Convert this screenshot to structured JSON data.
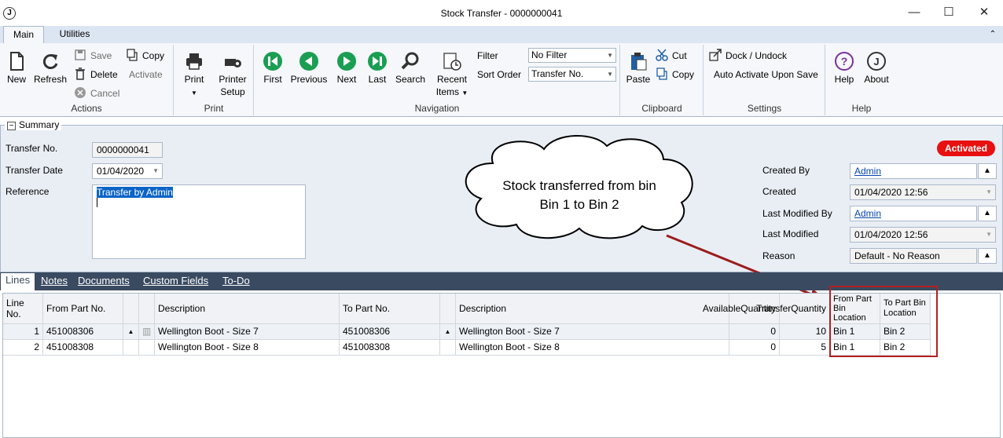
{
  "window": {
    "title": "Stock Transfer - 0000000041",
    "app_icon": "J",
    "min": "—",
    "max": "☐",
    "close": "✕"
  },
  "tabs": [
    {
      "label": "Main"
    },
    {
      "label": "Utilities"
    }
  ],
  "ribbon": {
    "actions": {
      "new": "New",
      "refresh": "Refresh",
      "save": "Save",
      "delete": "Delete",
      "cancel": "Cancel",
      "copy": "Copy",
      "activate": "Activate",
      "group": "Actions"
    },
    "print": {
      "print": "Print",
      "printer": "Printer",
      "setup": "Setup",
      "group": "Print"
    },
    "navigation": {
      "first": "First",
      "previous": "Previous",
      "next": "Next",
      "last": "Last",
      "search": "Search",
      "recent": "Recent",
      "items": "Items",
      "filter_label": "Filter",
      "filter_value": "No Filter",
      "sort_label": "Sort Order",
      "sort_value": "Transfer No.",
      "group": "Navigation"
    },
    "clipboard": {
      "paste": "Paste",
      "cut": "Cut",
      "copy": "Copy",
      "group": "Clipboard"
    },
    "settings": {
      "dock": "Dock / Undock",
      "auto": "Auto Activate Upon Save",
      "group": "Settings"
    },
    "help": {
      "help": "Help",
      "about": "About",
      "group": "Help"
    }
  },
  "summary": {
    "title": "Summary",
    "collapse": "−",
    "transfer_no_label": "Transfer No.",
    "transfer_no": "0000000041",
    "transfer_date_label": "Transfer Date",
    "transfer_date": "01/04/2020",
    "reference_label": "Reference",
    "reference": "Transfer by Admin",
    "status": "Activated",
    "created_by_label": "Created By",
    "created_by": "Admin",
    "created_label": "Created",
    "created": "01/04/2020 12:56",
    "last_modified_by_label": "Last Modified By",
    "last_modified_by": "Admin",
    "last_modified_label": "Last Modified",
    "last_modified": "01/04/2020 12:56",
    "reason_label": "Reason",
    "reason": "Default - No Reason"
  },
  "callout": {
    "line1": "Stock transferred from bin",
    "line2": "Bin 1 to Bin 2"
  },
  "line_tabs": [
    {
      "label": "Lines"
    },
    {
      "label": "Notes"
    },
    {
      "label": "Documents"
    },
    {
      "label": "Custom Fields"
    },
    {
      "label": "To-Do"
    }
  ],
  "grid": {
    "headers": {
      "line_no": "Line No.",
      "from_part": "From Part No.",
      "description": "Description",
      "to_part": "To Part No.",
      "description2": "Description",
      "available1": "Available",
      "available2": "Quantity",
      "transfer1": "Transfer",
      "transfer2": "Quantity",
      "from_bin1": "From Part",
      "from_bin2": "Bin",
      "from_bin3": "Location",
      "to_bin1": "To Part Bin",
      "to_bin2": "Location"
    },
    "rows": [
      {
        "line_no": "1",
        "from_part": "451008306",
        "description": "Wellington Boot - Size 7",
        "to_part": "451008306",
        "description2": "Wellington Boot - Size 7",
        "available": "0",
        "transfer": "10",
        "from_bin": "Bin 1",
        "to_bin": "Bin 2"
      },
      {
        "line_no": "2",
        "from_part": "451008308",
        "description": "Wellington Boot - Size 8",
        "to_part": "451008308",
        "description2": "Wellington Boot - Size 8",
        "available": "0",
        "transfer": "5",
        "from_bin": "Bin 1",
        "to_bin": "Bin 2"
      }
    ]
  },
  "colors": {
    "accent": "#1a9e52",
    "blue": "#1f5fa6",
    "status_red": "#e81010",
    "callout_arrow": "#9c1c1c"
  }
}
